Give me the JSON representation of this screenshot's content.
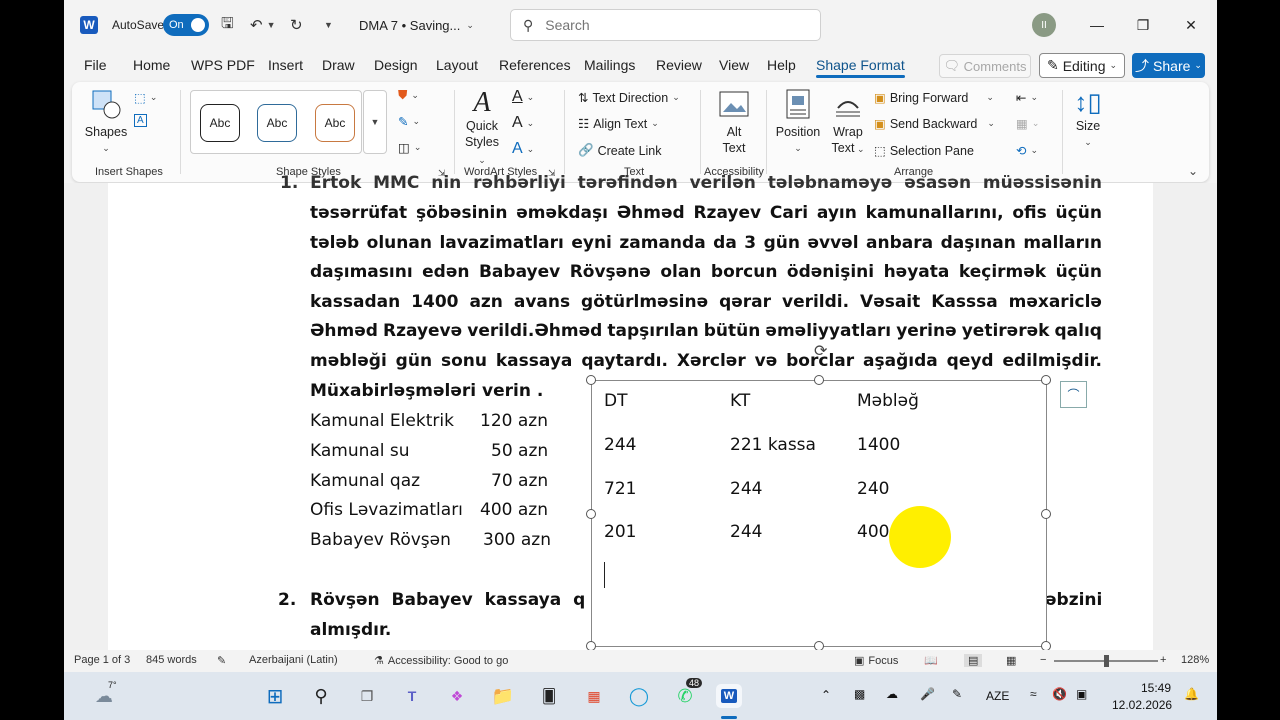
{
  "titlebar": {
    "app_letter": "W",
    "autosave_label": "AutoSave",
    "autosave_state": "On",
    "doc_title": "DMA 7 • Saving...",
    "search_placeholder": "Search",
    "avatar_initials": "II"
  },
  "tabs": [
    "File",
    "Home",
    "WPS PDF",
    "Insert",
    "Draw",
    "Design",
    "Layout",
    "References",
    "Mailings",
    "Review",
    "View",
    "Help",
    "Shape Format"
  ],
  "active_tab": "Shape Format",
  "tab_actions": {
    "comments": "Comments",
    "editing": "Editing",
    "share": "Share"
  },
  "ribbon": {
    "insert_shapes": {
      "shapes": "Shapes",
      "group": "Insert Shapes"
    },
    "shape_styles": {
      "abc1": "Abc",
      "abc2": "Abc",
      "abc3": "Abc",
      "group": "Shape Styles"
    },
    "wordart": {
      "quick": "Quick",
      "styles": "Styles",
      "group": "WordArt Styles"
    },
    "text": {
      "direction": "Text Direction",
      "align": "Align Text",
      "link": "Create Link",
      "group": "Text"
    },
    "accessibility": {
      "alt1": "Alt",
      "alt2": "Text",
      "group": "Accessibility"
    },
    "arrange": {
      "position": "Position",
      "wrap1": "Wrap",
      "wrap2": "Text",
      "forward": "Bring Forward",
      "backward": "Send Backward",
      "pane": "Selection Pane",
      "group": "Arrange"
    },
    "size": {
      "label": "Size"
    }
  },
  "colors": {
    "accent": "#0f6cbd",
    "word_blue": "#185abd",
    "highlight": "#ffef00"
  },
  "document": {
    "line0": "1. Ertok MMC nin rəhbərliyi tərəfindən verilən tələbnaməyə əsasən müəssisənin",
    "lines": [
      "təsərrüfat şöbəsinin əməkdaşı Əhməd Rzayev Cari ayın kamunallarını, ofis üçün",
      "tələb olunan lavazimatları eyni zamanda da  3 gün əvvəl anbara daşınan malların",
      "daşımasını edən Babayev Rövşənə olan  borcun ödənişini həyata keçirmək üçün",
      "kassadan 1400 azn avans götürlməsinə qərar verildi. Vəsait Kasssa məxariclə",
      "Əhməd Rzayevə verildi.Əhməd tapşırılan bütün əməliyyatları yerinə yetirərək qalıq",
      "məbləği gün sonu kassaya qaytardı. Xərclər və borclar aşağıda qeyd edilmişdir."
    ],
    "last_line": "Müxabirləşmələri verin .",
    "expenses": [
      {
        "name": "Kamunal Elektrik",
        "amount": "120 azn"
      },
      {
        "name": "Kamunal su",
        "amount": "50 azn"
      },
      {
        "name": "Kamunal qaz",
        "amount": "70 azn"
      },
      {
        "name": "Ofis Ləvazimatları",
        "amount": "400 azn"
      },
      {
        "name": "Babayev Rövşən",
        "amount": "300 azn"
      }
    ],
    "item2_num": "2.",
    "item2_left": "Rövşən Babayev kassaya q",
    "item2_right": "əbzini",
    "item2_line2": "almışdır."
  },
  "textbox": {
    "headers": [
      "DT",
      "KT",
      "Məbləğ"
    ],
    "rows": [
      [
        "244",
        "221 kassa",
        "1400"
      ],
      [
        "721",
        "244",
        "240"
      ],
      [
        "201",
        "244",
        "400"
      ]
    ]
  },
  "statusbar": {
    "page": "Page 1 of 3",
    "words": "845 words",
    "language": "Azerbaijani (Latin)",
    "accessibility": "Accessibility: Good to go",
    "focus": "Focus",
    "zoom": "128%"
  },
  "taskbar": {
    "weather": "7°",
    "badge": "48",
    "lang": "AZE",
    "time": "15:49",
    "date": "12.02.2026"
  }
}
